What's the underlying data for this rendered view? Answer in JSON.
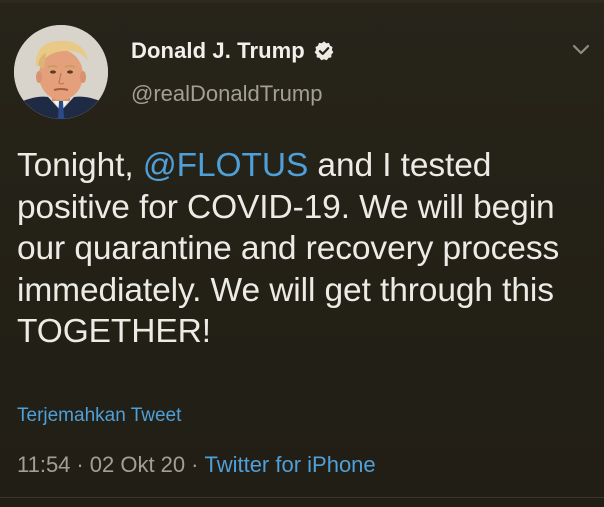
{
  "author": {
    "display_name": "Donald J. Trump",
    "handle": "@realDonaldTrump",
    "verified": true
  },
  "tweet": {
    "text_before": "Tonight, ",
    "mention": "@FLOTUS",
    "text_after": " and I tested positive for COVID-19. We will begin our quarantine and recovery process immediately. We will get through this TOGETHER!"
  },
  "translate_label": "Terjemahkan Tweet",
  "meta": {
    "time": "11:54",
    "separator": "·",
    "date": "02 Okt 20",
    "source": "Twitter for iPhone"
  },
  "icons": {
    "verified": "verified-badge-icon",
    "menu": "chevron-down-icon"
  },
  "colors": {
    "background": "#252216",
    "link": "#4f9fd8",
    "secondary_text": "#a39f92",
    "primary_text": "#ecebe5"
  }
}
